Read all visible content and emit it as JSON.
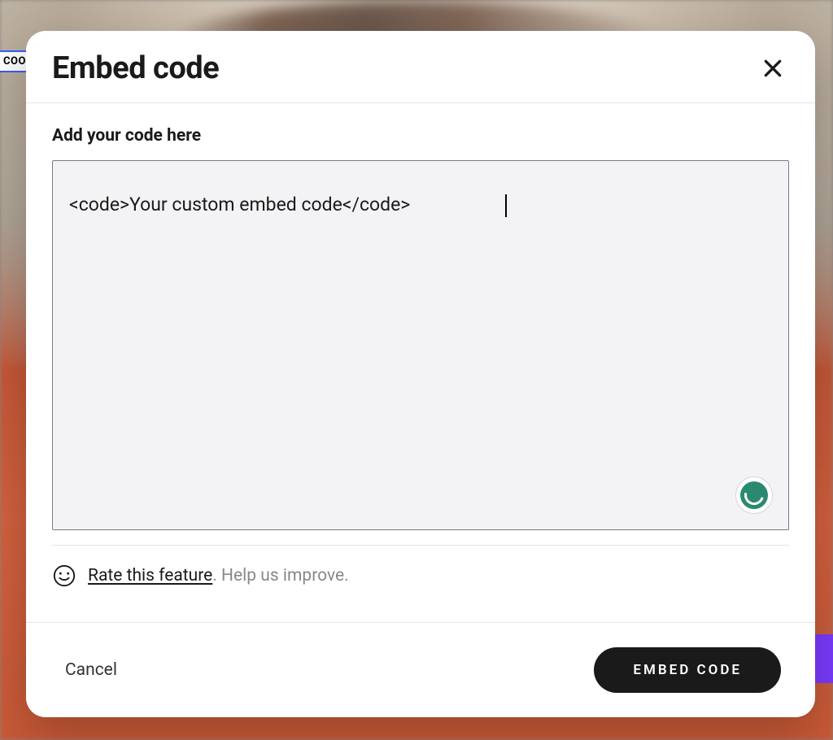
{
  "background": {
    "tab_label": "COO"
  },
  "modal": {
    "title": "Embed code",
    "field_label": "Add your code here",
    "code_value": "<code>Your custom embed code</code>",
    "rate": {
      "link_text": "Rate this feature",
      "suffix_text": ". Help us improve."
    },
    "footer": {
      "cancel_label": "Cancel",
      "submit_label": "EMBED CODE"
    }
  }
}
